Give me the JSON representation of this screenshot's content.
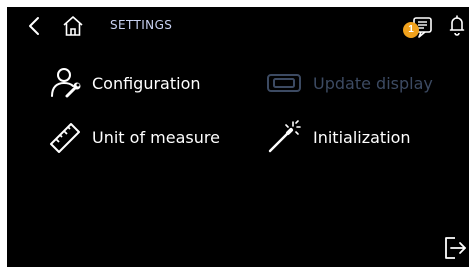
{
  "header": {
    "title": "SETTINGS",
    "back_icon": "chevron-left-icon",
    "home_icon": "home-icon",
    "messages_icon": "message-icon",
    "notification_count": "1",
    "alert_icon": "bell-icon",
    "badge_color": "#f0a11c",
    "title_color": "#c9d2f2"
  },
  "menu": {
    "items": [
      {
        "label": "Configuration",
        "icon": "user-wrench-icon",
        "enabled": true
      },
      {
        "label": "Update display",
        "icon": "display-icon",
        "enabled": false
      },
      {
        "label": "Unit of measure",
        "icon": "ruler-icon",
        "enabled": true
      },
      {
        "label": "Initialization",
        "icon": "magic-wand-icon",
        "enabled": true
      }
    ],
    "disabled_color": "#3c4a62"
  },
  "footer": {
    "logout_icon": "logout-icon"
  }
}
